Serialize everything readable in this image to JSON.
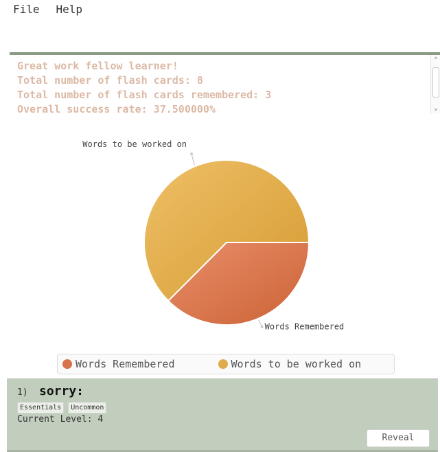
{
  "menu": {
    "items": [
      "File",
      "Help"
    ]
  },
  "summary": {
    "lines": [
      "Great work fellow learner!",
      "Total number of flash cards: 8",
      "Total number of flash cards remembered: 3",
      "Overall success rate: 37.500000%"
    ]
  },
  "colors": {
    "remembered": "#d9714a",
    "to_work_on": "#e0ab4a",
    "summary_text": "#dcb9a5",
    "card_bg": "#c1cdbd",
    "divider": "#8c9a83"
  },
  "chart_data": {
    "type": "pie",
    "series": [
      {
        "name": "Words Remembered",
        "value": 3
      },
      {
        "name": "Words to be worked on",
        "value": 5
      }
    ],
    "legend_placement": "bottom"
  },
  "card": {
    "number": "1)",
    "word": "sorry:",
    "tags": [
      "Essentials",
      "Uncommon"
    ],
    "level": "Current Level: 4",
    "reveal_label": "Reveal"
  }
}
